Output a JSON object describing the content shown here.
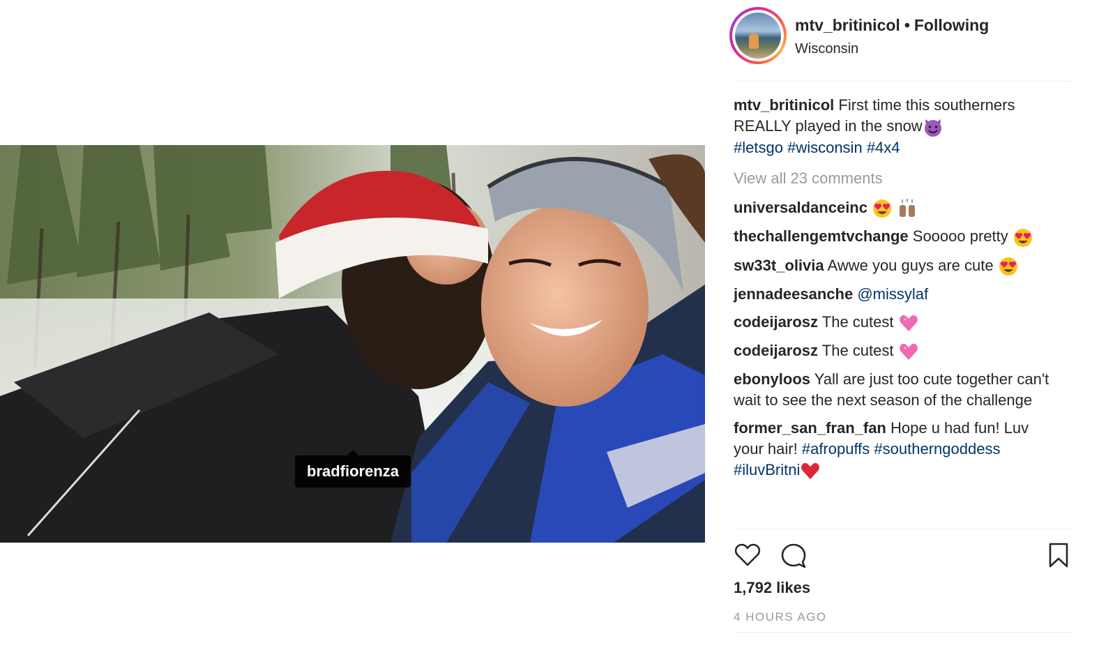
{
  "post": {
    "username": "mtv_britinicol",
    "separator": "•",
    "follow_status": "Following",
    "location": "Wisconsin",
    "photo_tag": "bradfiorenza",
    "caption": {
      "username": "mtv_britinicol",
      "text": "First time this southerners REALLY played in the snow",
      "emoji": "smiling-imp",
      "hashtags": [
        "#letsgo",
        "#wisconsin",
        "#4x4"
      ]
    },
    "view_all": "View all 23 comments",
    "comments": [
      {
        "user": "universaldanceinc",
        "text": "",
        "emojis": [
          "heart-eyes",
          "raised-hands"
        ]
      },
      {
        "user": "thechallengemtvchange",
        "text": "Sooooo pretty",
        "emojis": [
          "heart-eyes"
        ]
      },
      {
        "user": "sw33t_olivia",
        "text": "Awwe you guys are cute",
        "emojis": [
          "heart-eyes"
        ]
      },
      {
        "user": "jennadeesanche",
        "text": "",
        "mention": "@missylaf"
      },
      {
        "user": "codeijarosz",
        "text": "The cutest",
        "emojis": [
          "pink-heart"
        ]
      },
      {
        "user": "codeijarosz",
        "text": "The cutest",
        "emojis": [
          "pink-heart"
        ]
      },
      {
        "user": "ebonyloos",
        "text": "Yall are just too cute together can't wait to see the next season of the challenge"
      },
      {
        "user": "former_san_fran_fan",
        "text": "Hope u had fun! Luv your hair!",
        "hashtags": [
          "#afropuffs",
          "#southerngoddess",
          "#iluvBritni"
        ],
        "emojis": [
          "red-heart"
        ]
      }
    ],
    "likes": "1,792 likes",
    "timestamp": "4 HOURS AGO",
    "icons": {
      "like": "heart-icon",
      "comment": "comment-icon",
      "save": "bookmark-icon"
    },
    "colors": {
      "link": "#003569",
      "muted": "#999999",
      "text": "#262626"
    }
  }
}
